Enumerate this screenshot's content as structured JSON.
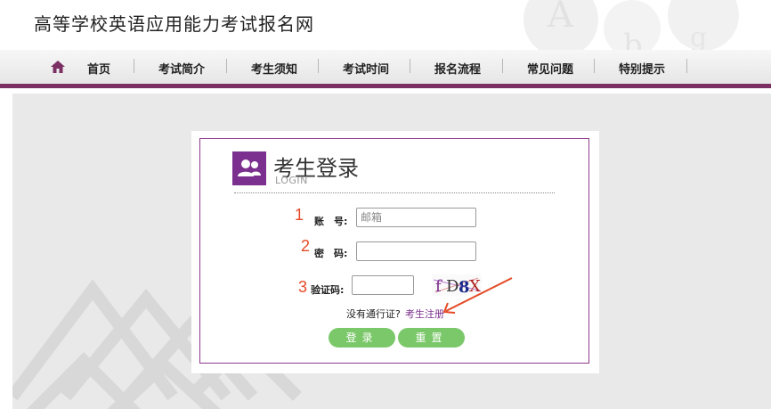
{
  "site": {
    "title": "高等学校英语应用能力考试报名网"
  },
  "nav": {
    "items": [
      "首页",
      "考试简介",
      "考生须知",
      "考试时间",
      "报名流程",
      "常见问题",
      "特别提示"
    ]
  },
  "login": {
    "title": "考生登录",
    "subtitle": "LOGIN",
    "fields": [
      {
        "number": "1",
        "label": "账　号:",
        "value": "",
        "placeholder": "邮箱"
      },
      {
        "number": "2",
        "label": "密　码:",
        "value": "",
        "placeholder": ""
      },
      {
        "number": "3",
        "label": "验证码:",
        "value": "",
        "placeholder": ""
      }
    ],
    "captcha_text": "fD8X",
    "no_pass_text": "没有通行证?",
    "register_link": "考生注册",
    "login_button": "登录",
    "reset_button": "重置"
  },
  "colors": {
    "brand": "#7b2f63",
    "accent_purple": "#7b2f8f",
    "button_green": "#7bc86a",
    "annotation_red": "#e44a26"
  },
  "icons": {
    "home": "home-icon",
    "login_badge": "users-icon"
  }
}
